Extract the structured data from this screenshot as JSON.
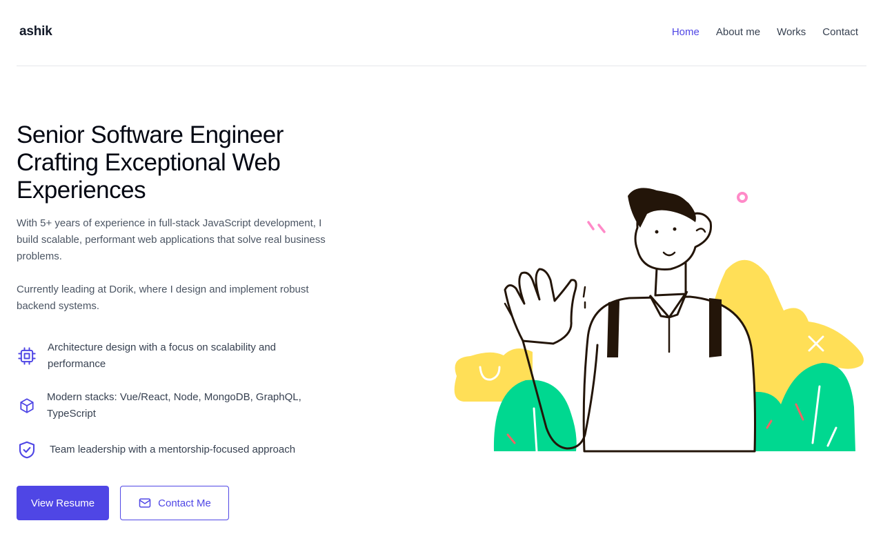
{
  "header": {
    "logo": "ashik",
    "nav": [
      {
        "label": "Home",
        "active": true
      },
      {
        "label": "About me",
        "active": false
      },
      {
        "label": "Works",
        "active": false
      },
      {
        "label": "Contact",
        "active": false
      }
    ]
  },
  "hero": {
    "title": "Senior Software Engineer Crafting Exceptional Web Experiences",
    "paragraphs": [
      "With 5+ years of experience in full-stack JavaScript development, I build scalable, performant web applications that solve real business problems.",
      "Currently leading at Dorik, where I design and implement robust backend systems."
    ],
    "features": [
      {
        "icon": "cpu-chip-icon",
        "text": "Architecture design with a focus on scalability and performance"
      },
      {
        "icon": "cube-icon",
        "text": "Modern stacks: Vue/React, Node, MongoDB, GraphQL, TypeScript"
      },
      {
        "icon": "shield-check-icon",
        "text": "Team leadership with a mentorship-focused approach"
      }
    ],
    "buttons": {
      "primary": "View Resume",
      "secondary": "Contact Me",
      "secondary_icon": "mail-icon"
    }
  },
  "colors": {
    "accent": "#4f46e5",
    "text_dark": "#111827",
    "text_muted": "#4b5563",
    "illustration_yellow": "#ffdf57",
    "illustration_green": "#00d890",
    "illustration_pink": "#ff8ac8",
    "illustration_outline": "#231509"
  }
}
